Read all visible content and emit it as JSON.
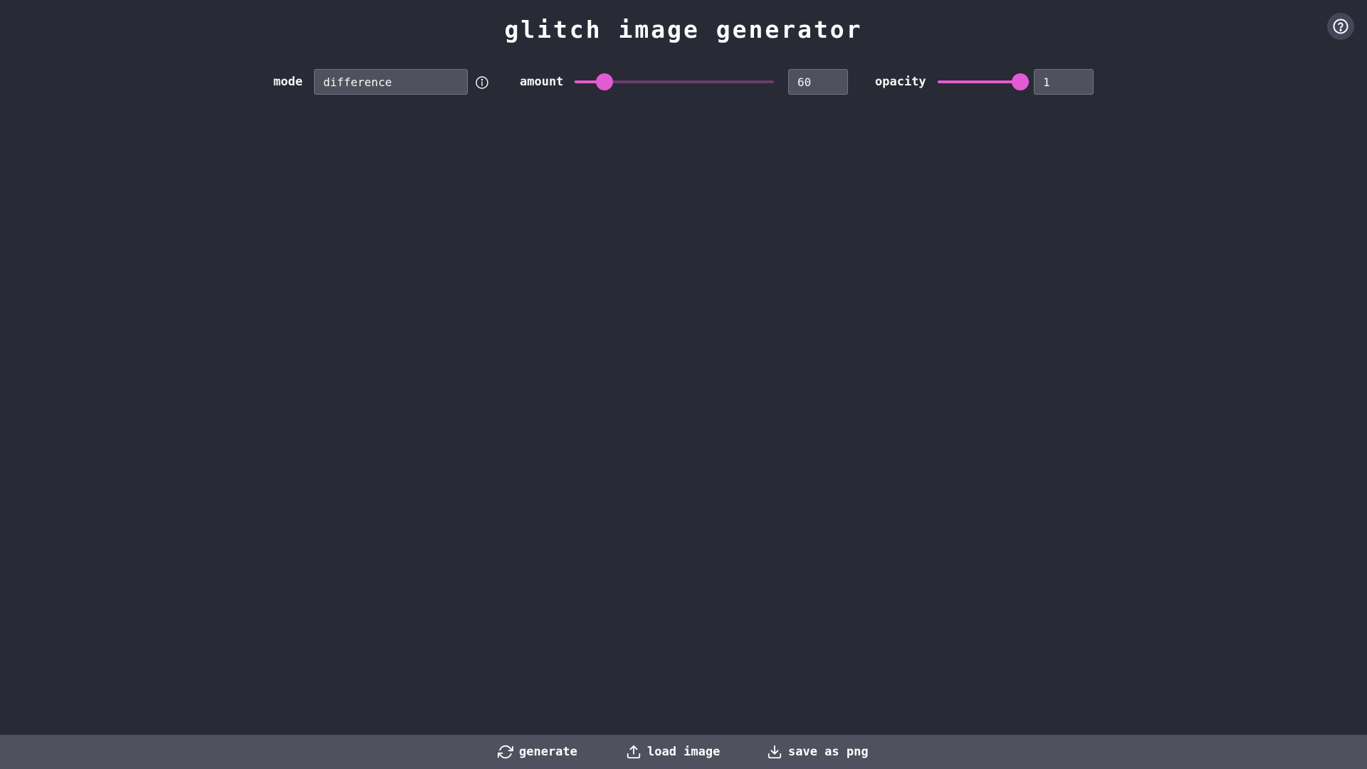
{
  "header": {
    "title": "glitch image generator",
    "help_icon": "help-circle-icon"
  },
  "controls": {
    "mode": {
      "label": "mode",
      "value": "difference",
      "info_icon": "info-icon"
    },
    "amount": {
      "label": "amount",
      "value": "60",
      "slider_fraction": 0.15
    },
    "opacity": {
      "label": "opacity",
      "value": "1",
      "slider_fraction": 0.9
    }
  },
  "toolbar": {
    "generate_label": "generate",
    "generate_icon": "refresh-icon",
    "load_label": "load image",
    "load_icon": "upload-icon",
    "save_label": "save as png",
    "save_icon": "download-icon"
  },
  "colors": {
    "background": "#282a36",
    "bar": "#4f525e",
    "accent": "#e35bd3",
    "track": "#6b3c6b"
  }
}
